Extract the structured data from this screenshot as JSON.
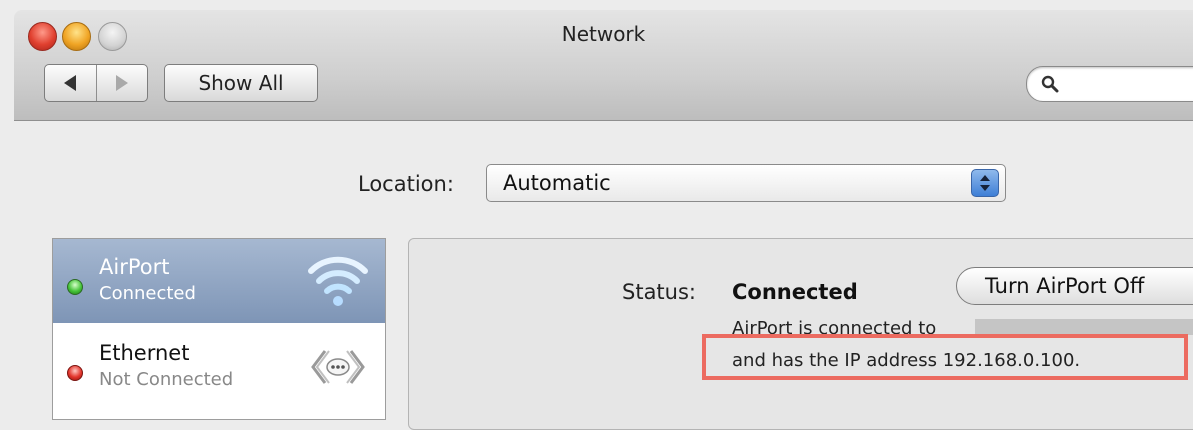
{
  "window": {
    "title": "Network"
  },
  "toolbar": {
    "show_all_label": "Show All",
    "search_placeholder": ""
  },
  "location": {
    "label": "Location:",
    "value": "Automatic"
  },
  "services": [
    {
      "name": "AirPort",
      "status": "Connected",
      "selected": true,
      "status_color": "#47c43a",
      "icon": "wifi-icon"
    },
    {
      "name": "Ethernet",
      "status": "Not Connected",
      "selected": false,
      "status_color": "#e2342b",
      "icon": "ethernet-icon"
    }
  ],
  "detail": {
    "status_label": "Status:",
    "status_value": "Connected",
    "toggle_button": "Turn AirPort Off",
    "description_line1": "AirPort is connected to",
    "description_line2": "and has the IP address 192.168.0.100."
  },
  "colors": {
    "selection": "#8fa3c0",
    "highlight_box": "#ec6b60"
  }
}
